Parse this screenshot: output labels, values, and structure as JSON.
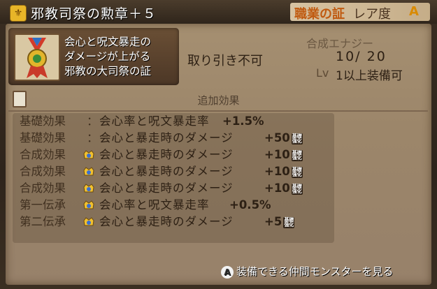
{
  "header": {
    "title": "邪教司祭の勲章＋５",
    "job_label": "職業の証",
    "rarity_label": "レア度",
    "rarity_value": "A"
  },
  "item": {
    "description_lines": [
      "会心と呪文暴走の",
      "ダメージが上がる",
      "邪教の大司祭の証"
    ],
    "trade_status": "取り引き不可",
    "synthesis_label": "合成エナジー",
    "synthesis_value": "10/ 20",
    "level_label": "Lv",
    "level_value": "1以上装備可"
  },
  "effects": {
    "heading": "追加効果",
    "rows": [
      {
        "category": "基礎効果",
        "gem": false,
        "desc": "会心率と呪文暴走率",
        "value": "+1.5%",
        "tag": ""
      },
      {
        "category": "基礎効果",
        "gem": false,
        "desc": "会心と暴走時のダメージ",
        "value": "+50",
        "tag": "基礎\n強化"
      },
      {
        "category": "合成効果",
        "gem": true,
        "desc": "会心と暴走時のダメージ",
        "value": "+10",
        "tag": "基礎\n強化"
      },
      {
        "category": "合成効果",
        "gem": true,
        "desc": "会心と暴走時のダメージ",
        "value": "+10",
        "tag": "基礎\n強化"
      },
      {
        "category": "合成効果",
        "gem": true,
        "desc": "会心と暴走時のダメージ",
        "value": "+10",
        "tag": "基礎\n強化"
      },
      {
        "category": "第一伝承",
        "gem": true,
        "desc": "会心率と呪文暴走率",
        "value": "+0.5%",
        "tag": ""
      },
      {
        "category": "第二伝承",
        "gem": true,
        "desc": "会心と暴走時のダメージ",
        "value": "+5",
        "tag": "基礎\n強化"
      }
    ]
  },
  "footer": {
    "button": "A",
    "text": "装備できる仲間モンスターを見る"
  },
  "colors": {
    "job_label": "#c05a10",
    "rarity_value": "#d98a00",
    "panel": "#a58f71"
  }
}
